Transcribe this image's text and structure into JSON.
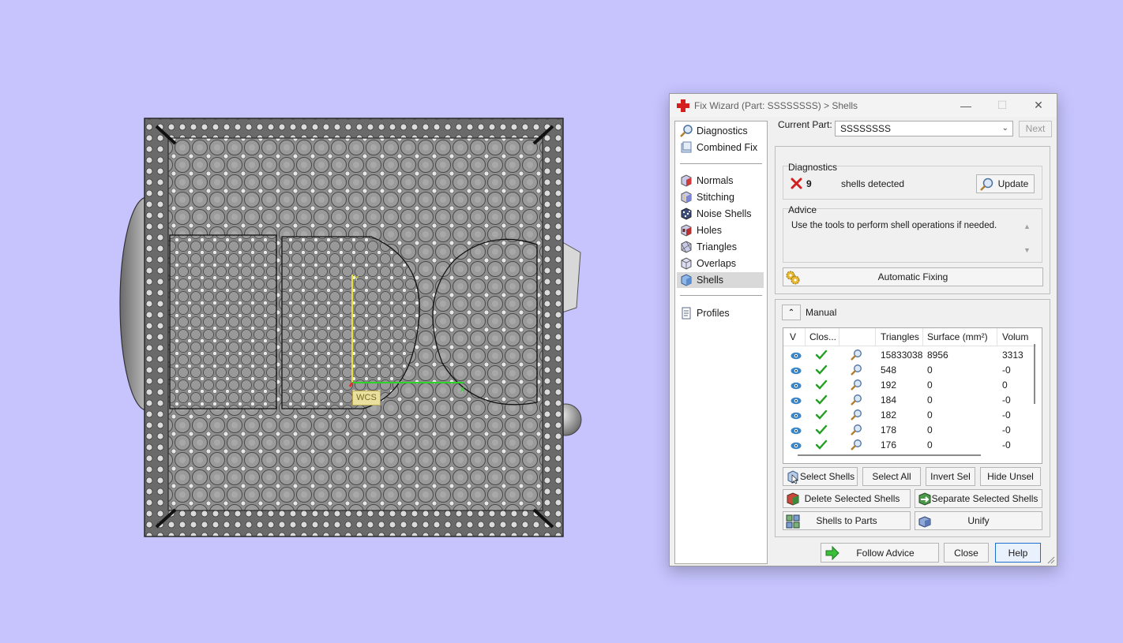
{
  "dialog": {
    "title": "Fix Wizard (Part: SSSSSSSS) > Shells",
    "window_buttons": [
      "minimize",
      "maximize",
      "close"
    ]
  },
  "nav": {
    "items": [
      {
        "label": "Diagnostics",
        "icon": "magnifier-icon"
      },
      {
        "label": "Combined Fix",
        "icon": "combined-fix-icon"
      },
      {
        "label": "Normals",
        "icon": "normals-cube-icon"
      },
      {
        "label": "Stitching",
        "icon": "stitching-cube-icon"
      },
      {
        "label": "Noise Shells",
        "icon": "noise-shells-icon"
      },
      {
        "label": "Holes",
        "icon": "holes-cube-icon"
      },
      {
        "label": "Triangles",
        "icon": "triangles-cube-icon"
      },
      {
        "label": "Overlaps",
        "icon": "overlaps-cube-icon"
      },
      {
        "label": "Shells",
        "icon": "shells-cube-icon",
        "selected": true
      },
      {
        "label": "Profiles",
        "icon": "profiles-document-icon"
      }
    ]
  },
  "current_part": {
    "label": "Current Part:",
    "value": "SSSSSSSS",
    "next_label": "Next"
  },
  "diagnostics": {
    "label": "Diagnostics",
    "count": "9",
    "text": "shells detected",
    "update_label": "Update",
    "status_icon": "red-x-icon"
  },
  "advice": {
    "label": "Advice",
    "text": "Use the tools to perform shell operations if needed."
  },
  "automatic_fixing_label": "Automatic Fixing",
  "manual": {
    "label": "Manual",
    "columns": [
      "V",
      "Clos...",
      "",
      "Triangles",
      "Surface (mm²)",
      "Volum"
    ],
    "rows": [
      {
        "triangles": "15833038",
        "surface": "8956",
        "volume": "3313"
      },
      {
        "triangles": "548",
        "surface": "0",
        "volume": "-0"
      },
      {
        "triangles": "192",
        "surface": "0",
        "volume": "0"
      },
      {
        "triangles": "184",
        "surface": "0",
        "volume": "-0"
      },
      {
        "triangles": "182",
        "surface": "0",
        "volume": "-0"
      },
      {
        "triangles": "178",
        "surface": "0",
        "volume": "-0"
      },
      {
        "triangles": "176",
        "surface": "0",
        "volume": "-0"
      }
    ]
  },
  "actions": {
    "select_shells": "Select Shells",
    "select_all": "Select All",
    "invert_sel": "Invert Sel",
    "hide_unsel": "Hide Unsel",
    "delete_selected": "Delete Selected Shells",
    "separate_selected": "Separate Selected Shells",
    "shells_to_parts": "Shells to Parts",
    "unify": "Unify"
  },
  "footer": {
    "follow_advice": "Follow Advice",
    "close": "Close",
    "help": "Help"
  },
  "viewport": {
    "axis_label": "WCS",
    "background_color": "#c6c3fd"
  },
  "colors": {
    "accent_blue": "#1f6fd0",
    "check_green": "#22a022",
    "error_red": "#d02020",
    "eye_blue": "#3a86c8"
  }
}
